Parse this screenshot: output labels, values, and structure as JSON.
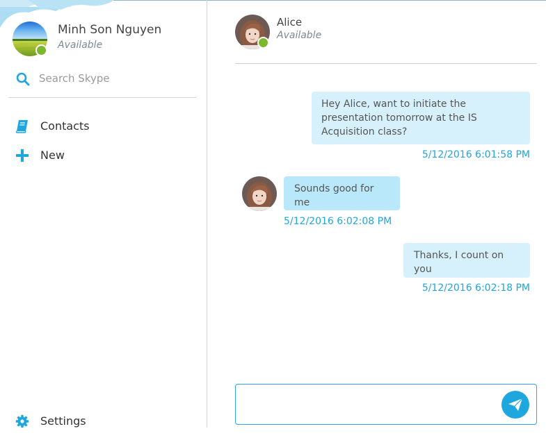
{
  "profile": {
    "name": "Minh Son Nguyen",
    "status": "Available"
  },
  "search": {
    "placeholder": "Search Skype"
  },
  "nav": {
    "contacts": "Contacts",
    "new": "New",
    "settings": "Settings"
  },
  "chat": {
    "contact_name": "Alice",
    "contact_status": "Available",
    "messages": [
      {
        "direction": "outgoing",
        "text": "Hey Alice, want to initiate the presentation tomorrow at the IS Acquisition class?",
        "time": "5/12/2016 6:01:58 PM"
      },
      {
        "direction": "incoming",
        "text": "Sounds good for me",
        "time": "5/12/2016 6:02:08 PM"
      },
      {
        "direction": "outgoing",
        "text": "Thanks, I count on you",
        "time": "5/12/2016 6:02:18 PM"
      }
    ],
    "composer_value": ""
  },
  "colors": {
    "accent": "#1ea6de",
    "status_available": "#7cb82f",
    "bubble_outgoing": "#d6f1fb",
    "bubble_incoming": "#b9e8fb"
  },
  "icons": {
    "search": "search-icon",
    "contacts": "book-icon",
    "new": "plus-icon",
    "settings": "gear-icon",
    "send": "paper-plane-icon"
  }
}
